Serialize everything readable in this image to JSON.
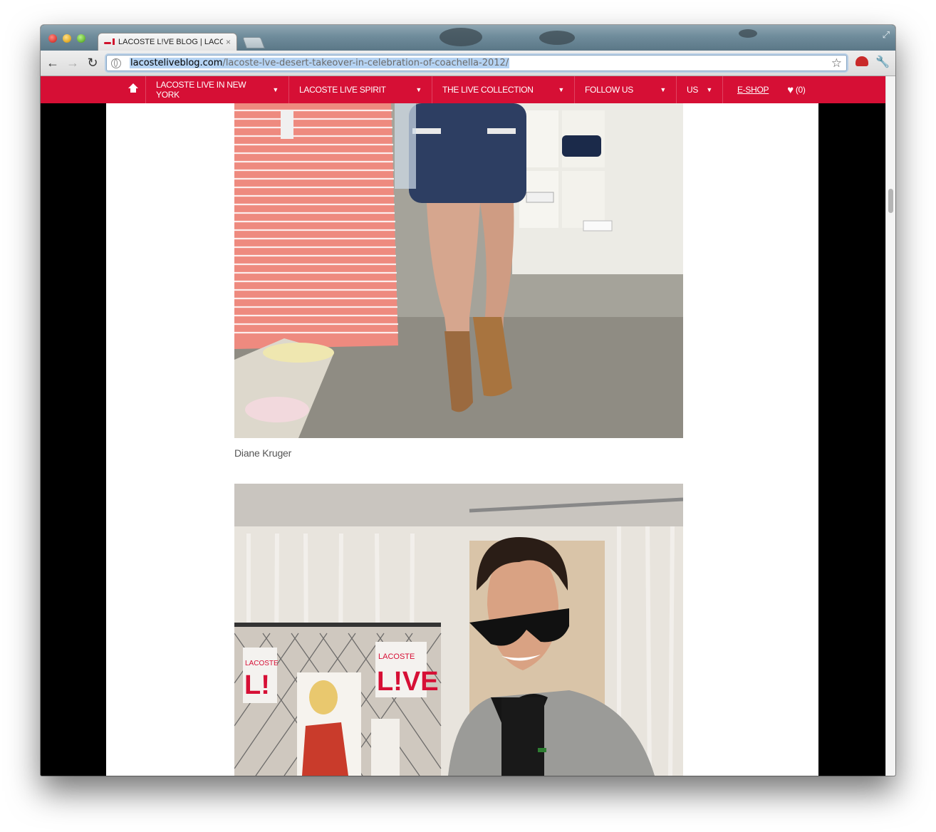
{
  "browser": {
    "tab_title": "LACOSTE L!VE BLOG | LACOS",
    "tab_close": "×",
    "url_domain": "lacosteliveblog.com",
    "url_path": "/lacoste-lve-desert-takeover-in-celebration-of-coachella-2012/",
    "icons": [
      "back-icon",
      "forward-icon",
      "reload-icon",
      "globe-icon",
      "star-icon",
      "extension-icon",
      "wrench-icon"
    ]
  },
  "site_nav": {
    "items": [
      {
        "label": "LACOSTE LIVE IN NEW YORK",
        "has_dropdown": true
      },
      {
        "label": "LACOSTE LIVE SPIRIT",
        "has_dropdown": true
      },
      {
        "label": "THE LIVE COLLECTION",
        "has_dropdown": true
      },
      {
        "label": "FOLLOW US",
        "has_dropdown": true
      },
      {
        "label": "US",
        "has_dropdown": true
      }
    ],
    "eshop": "E-SHOP",
    "wishlist_count": "(0)"
  },
  "post": {
    "photo_1_caption": "Diane Kruger"
  },
  "colors": {
    "nav_red": "#d60f35",
    "page_bg": "#000000",
    "content_bg": "#ffffff"
  }
}
